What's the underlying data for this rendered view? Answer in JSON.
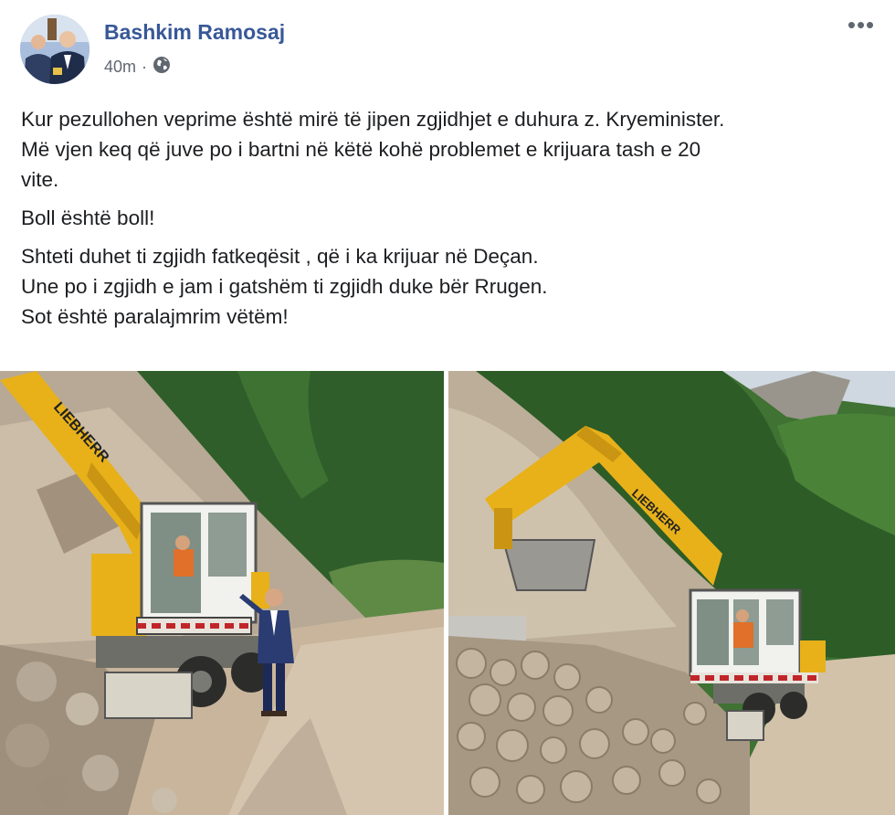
{
  "post": {
    "author": "Bashkim Ramosaj",
    "time": "40m",
    "separator": "·",
    "audience_icon": "globe-icon",
    "more_icon": "ellipsis-icon",
    "more_label": "•••",
    "paragraphs": [
      [
        "Kur pezullohen veprime është mirë të jipen zgjidhjet e duhura z. Kryeminister.",
        "Më vjen keq që juve po i bartni në këtë kohë problemet e krijuara tash e 20",
        "vite."
      ],
      [
        "Boll është boll!"
      ],
      [
        "Shteti duhet ti zgjidh fatkeqësit , që i ka krijuar në Deçan.",
        "Une po i zgjidh e jam i gatshëm ti zgjidh duke bër Rrugen.",
        "Sot është paralajmrim vëtëm!"
      ]
    ],
    "photos": [
      {
        "brand_text": "LIEBHERR"
      },
      {
        "brand_text": "LIEBHERR"
      }
    ]
  },
  "colors": {
    "author": "#385898",
    "meta": "#616770",
    "text": "#1c1e21",
    "excavator": "#e8b11a"
  }
}
